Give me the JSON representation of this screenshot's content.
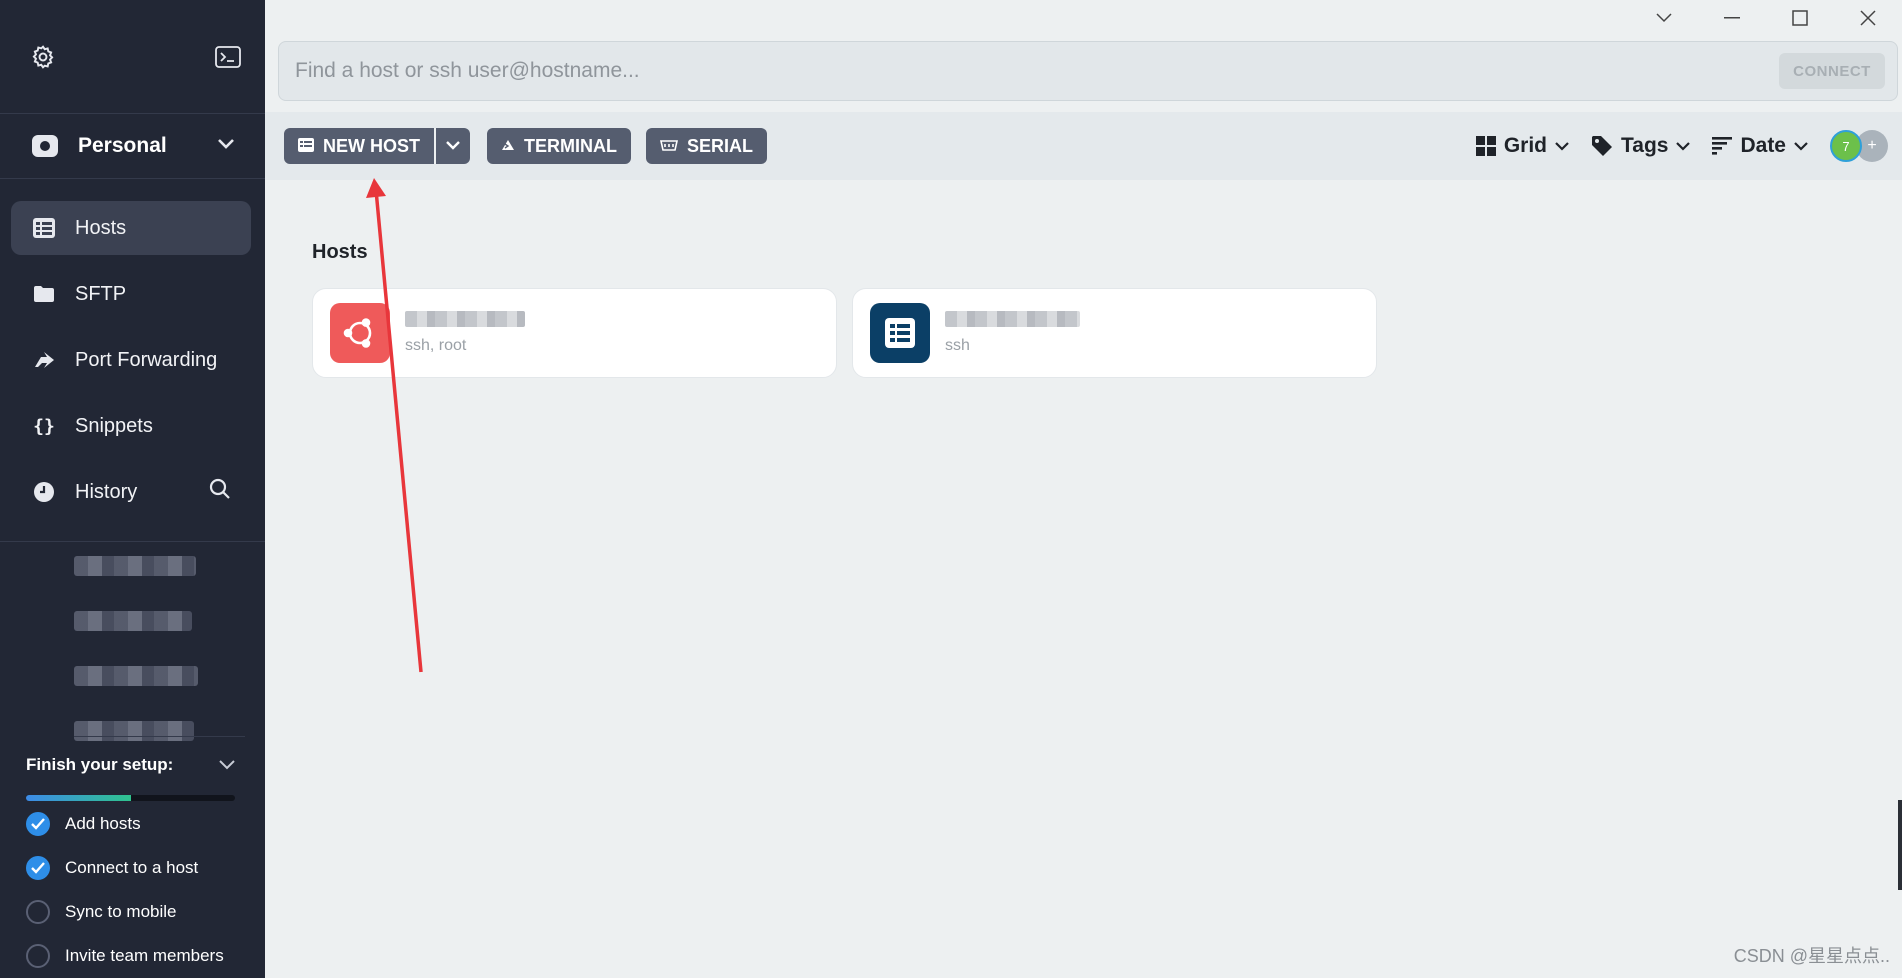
{
  "sidebar": {
    "vault_label": "Personal",
    "nav": [
      {
        "label": "Hosts",
        "icon": "hosts-icon"
      },
      {
        "label": "SFTP",
        "icon": "folder-icon"
      },
      {
        "label": "Port Forwarding",
        "icon": "port-forwarding-icon"
      },
      {
        "label": "Snippets",
        "icon": "braces-icon"
      },
      {
        "label": "History",
        "icon": "clock-icon"
      }
    ],
    "snippets_glyph": "{}",
    "setup": {
      "title": "Finish your setup:",
      "progress": 0.5,
      "tasks": [
        {
          "label": "Add hosts",
          "done": true
        },
        {
          "label": "Connect to a host",
          "done": true
        },
        {
          "label": "Sync to mobile",
          "done": false
        },
        {
          "label": "Invite team members",
          "done": false
        }
      ]
    }
  },
  "search": {
    "placeholder": "Find a host or ssh user@hostname...",
    "connect_label": "CONNECT"
  },
  "toolbar": {
    "new_host_label": "NEW HOST",
    "terminal_label": "TERMINAL",
    "serial_label": "SERIAL",
    "grid_label": "Grid",
    "tags_label": "Tags",
    "date_label": "Date",
    "avatar_count": "7",
    "avatar_add": "+"
  },
  "main": {
    "section_title": "Hosts",
    "hosts": [
      {
        "subtitle": "ssh, root",
        "icon": "ubuntu-icon",
        "color": "#ef5a5a"
      },
      {
        "subtitle": "ssh",
        "icon": "server-icon",
        "color": "#0b3f66"
      }
    ]
  },
  "colors": {
    "sidebar_bg": "#222735",
    "accent": "#2e8ee8",
    "annotation_arrow": "#e8363b"
  },
  "watermark": "CSDN @星星点点.."
}
